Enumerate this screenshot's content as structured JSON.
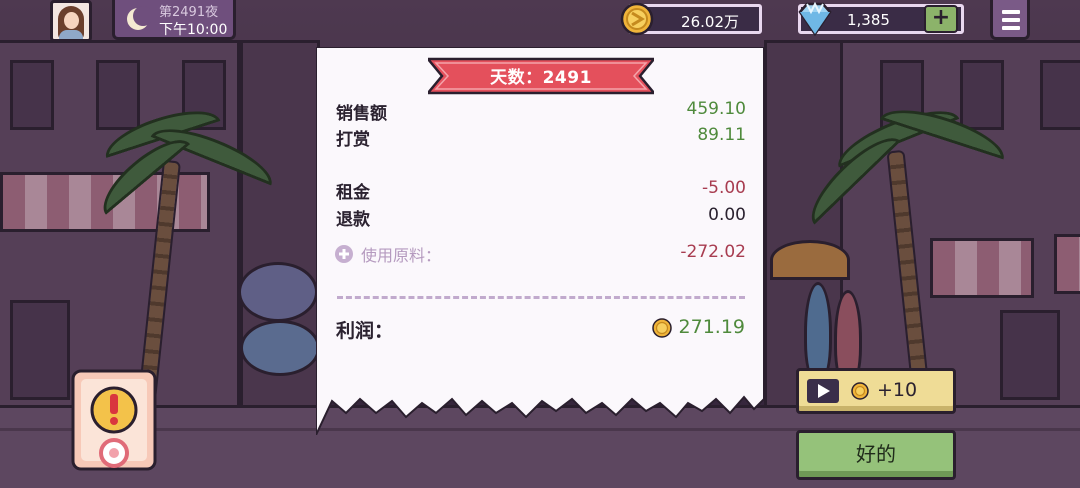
{
  "hud": {
    "night_label": "第2491夜",
    "time_label": "下午10:00",
    "coins": "26.02万",
    "gems": "1,385",
    "plus_label": "+"
  },
  "receipt": {
    "day_label": "天数：2491",
    "rows": [
      {
        "label": "销售额",
        "value": "459.10"
      },
      {
        "label": "打赏",
        "value": "89.11"
      },
      {
        "label": "租金",
        "value": "-5.00"
      },
      {
        "label": "退款",
        "value": "0.00"
      }
    ],
    "materials_label": "使用原料：",
    "materials_value": "-272.02",
    "profit_label": "利润：",
    "profit_value": "271.19"
  },
  "buttons": {
    "ad_reward": "+10",
    "ok": "好的"
  },
  "colors": {
    "positive": "#4f8a3c",
    "negative": "#a83c50",
    "banner": "#e4505c",
    "ok_button": "#95c27a",
    "ad_button": "#efdc96"
  }
}
